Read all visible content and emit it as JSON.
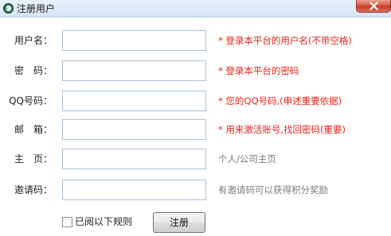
{
  "window": {
    "title": "注册用户",
    "close_icon": "close-x-icon",
    "app_icon": "app-logo-icon"
  },
  "form": {
    "rows": [
      {
        "label": "用户名：",
        "value": "",
        "hint": "* 登录本平台的用户名(不带空格)",
        "required": true
      },
      {
        "label": "密　码：",
        "value": "",
        "hint": "* 登录本平台的密码",
        "required": true
      },
      {
        "label": "QQ号码：",
        "value": "",
        "hint": "* 您的QQ号码,(申述重要依据)",
        "required": true
      },
      {
        "label": "邮　箱：",
        "value": "",
        "hint": "* 用来激活账号,找回密码(重要)",
        "required": true
      },
      {
        "label": "主　页：",
        "value": "",
        "hint": "个人/公司主页",
        "required": false
      },
      {
        "label": "邀请码：",
        "value": "",
        "hint": "有邀请码可以获得积分奖励",
        "required": false
      }
    ],
    "agree_label": "已阅以下规则",
    "agree_checked": false,
    "submit_label": "注册"
  },
  "colors": {
    "required_hint": "#e8231a",
    "optional_hint": "#7b7b7b",
    "input_border": "#abc0d8"
  }
}
